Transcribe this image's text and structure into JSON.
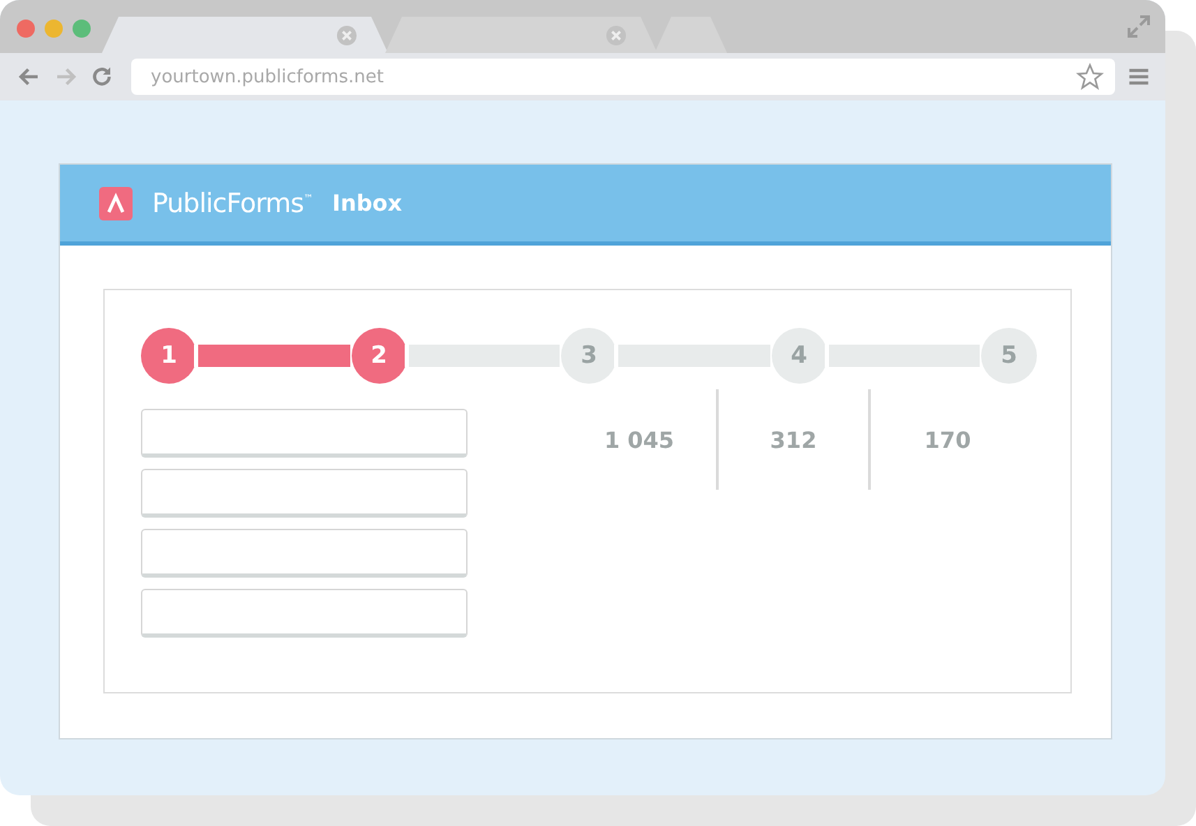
{
  "browser": {
    "tabs": [
      {
        "selected": true
      },
      {
        "selected": false
      }
    ],
    "address": "yourtown.publicforms.net"
  },
  "app": {
    "brand": "PublicForms",
    "trademark": "™",
    "title": "Inbox"
  },
  "steps": [
    {
      "label": "1",
      "done": true
    },
    {
      "label": "2",
      "done": true
    },
    {
      "label": "3",
      "done": false
    },
    {
      "label": "4",
      "done": false
    },
    {
      "label": "5",
      "done": false
    }
  ],
  "fields": [
    {
      "kind": "text"
    },
    {
      "kind": "text"
    },
    {
      "kind": "text"
    },
    {
      "kind": "text"
    }
  ],
  "stats": [
    "1 045",
    "312",
    "170"
  ]
}
